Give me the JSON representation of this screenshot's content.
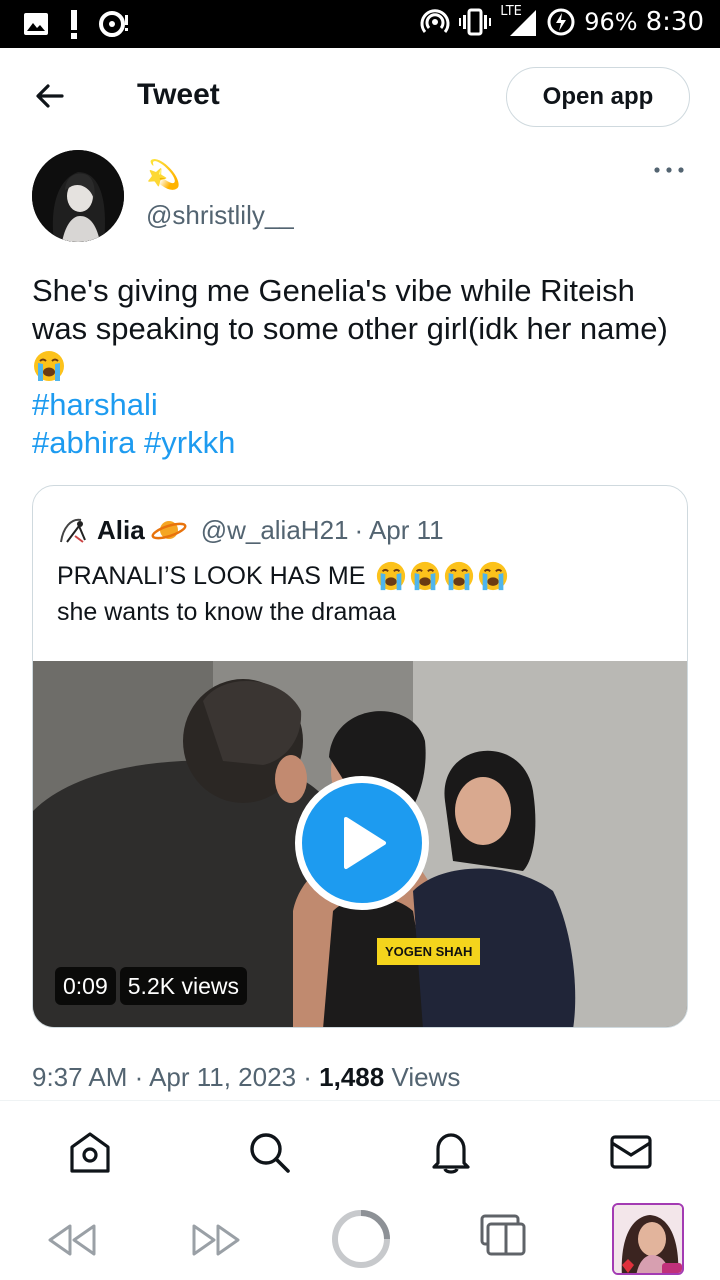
{
  "status_bar": {
    "network": "LTE",
    "battery": "96%",
    "time": "8:30"
  },
  "header": {
    "title": "Tweet",
    "open_app_label": "Open app"
  },
  "tweet": {
    "display_name_emoji": "💫",
    "handle": "@shristlily__",
    "text_line1": "She's giving me Genelia's vibe while Riteish was speaking to some other girl(idk her name)",
    "hashtags_line1": [
      "#harshali"
    ],
    "hashtags_line2": [
      "#abhira",
      "#yrkkh"
    ],
    "timestamp": "9:37 AM · Apr 11, 2023 · ",
    "views_count": "1,488",
    "views_label": "Views"
  },
  "quoted": {
    "name": "Alia",
    "handle": "@w_aliaH21",
    "date": "· Apr 11",
    "line1": "PRANALI’S LOOK HAS ME",
    "line2": "she wants to know the dramaa",
    "video": {
      "duration": "0:09",
      "views": "5.2K views",
      "caption_tag": "YOGEN SHAH"
    }
  },
  "bottom_nav": [
    "home-icon",
    "search-icon",
    "notifications-icon",
    "messages-icon"
  ],
  "system_nav": [
    "back-icon",
    "forward-icon",
    "home-circle-icon",
    "tabs-icon",
    "profile-thumbnail"
  ],
  "colors": {
    "accent": "#1d9bf0",
    "text_primary": "#0f1419",
    "text_secondary": "#536471",
    "border": "#cfd9de"
  }
}
